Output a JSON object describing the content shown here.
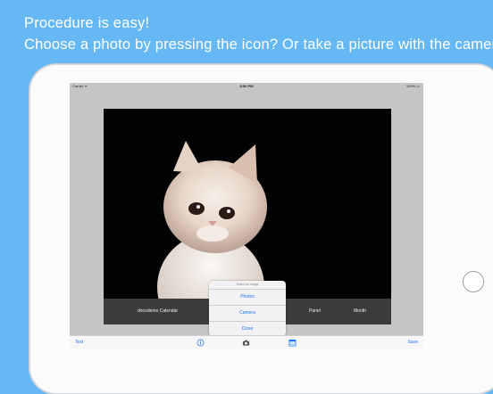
{
  "headline": {
    "line1": "Procedure is easy!",
    "line2": "Choose a photo by pressing the icon?  Or take a picture with the camera?"
  },
  "statusbar": {
    "carrier": "Carrier ᯤ",
    "time": "8:50 PM",
    "battery": "100% ▭"
  },
  "panel": {
    "calendar_name": "docodemo Calendar",
    "panel_label": "Panel",
    "month_label": "Month"
  },
  "action_sheet": {
    "title": "Select an image",
    "options": [
      "Photos",
      "Camera",
      "Close"
    ]
  },
  "bottombar": {
    "left_label": "Text",
    "right_label": "Save",
    "icons": [
      "info-icon",
      "camera-icon",
      "calendar-icon"
    ]
  },
  "colors": {
    "background": "#66b8f5",
    "accent": "#1976f0"
  }
}
